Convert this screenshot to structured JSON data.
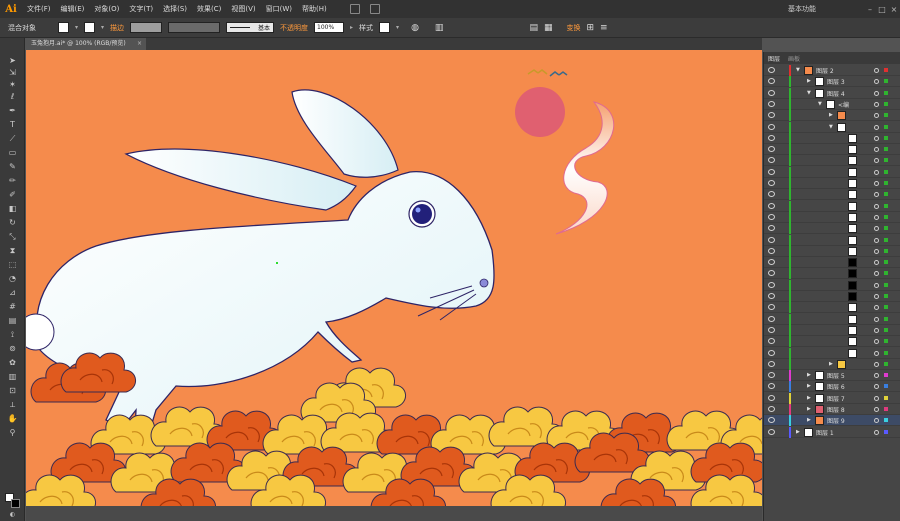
{
  "app": {
    "logo": "Ai",
    "workspace": "基本功能"
  },
  "menu": [
    "文件(F)",
    "编辑(E)",
    "对象(O)",
    "文字(T)",
    "选择(S)",
    "效果(C)",
    "视图(V)",
    "窗口(W)",
    "帮助(H)"
  ],
  "control": {
    "object_type": "混合对象",
    "stroke_label": "描边",
    "basic_label": "基本",
    "opacity_label": "不透明度",
    "opacity_value": "100%",
    "style_label": "样式",
    "transform_label": "变换"
  },
  "tab": {
    "title": "玉兔抱月.ai* @ 100% (RGB/预览)",
    "close": "×"
  },
  "panel": {
    "tab_layers": "图层",
    "tab_artboards": "画板"
  },
  "layers": [
    {
      "name": "图层 2",
      "indent": 0,
      "color": "#e03030",
      "expanded": true,
      "thumb": "#f58b4c"
    },
    {
      "name": "图层 3",
      "indent": 1,
      "color": "#2fb52f",
      "expanded": false,
      "thumb": "#ffffff"
    },
    {
      "name": "图层 4",
      "indent": 1,
      "color": "#2fb52f",
      "expanded": true,
      "thumb": "#ffffff"
    },
    {
      "name": "<编",
      "indent": 2,
      "color": "#2fb52f",
      "expanded": true,
      "thumb": "#ffffff"
    },
    {
      "name": "",
      "indent": 3,
      "color": "#2fb52f",
      "expanded": false,
      "thumb": "#f58b4c"
    },
    {
      "name": "",
      "indent": 3,
      "color": "#2fb52f",
      "expanded": true,
      "thumb": "#ffffff"
    },
    {
      "name": "",
      "indent": 4,
      "color": "#2fb52f",
      "thumb": "#ffffff"
    },
    {
      "name": "",
      "indent": 4,
      "color": "#2fb52f",
      "thumb": "#ffffff"
    },
    {
      "name": "",
      "indent": 4,
      "color": "#2fb52f",
      "thumb": "#ffffff"
    },
    {
      "name": "",
      "indent": 4,
      "color": "#2fb52f",
      "thumb": "#ffffff"
    },
    {
      "name": "",
      "indent": 4,
      "color": "#2fb52f",
      "thumb": "#ffffff"
    },
    {
      "name": "",
      "indent": 4,
      "color": "#2fb52f",
      "thumb": "#ffffff"
    },
    {
      "name": "",
      "indent": 4,
      "color": "#2fb52f",
      "thumb": "#ffffff"
    },
    {
      "name": "",
      "indent": 4,
      "color": "#2fb52f",
      "thumb": "#ffffff"
    },
    {
      "name": "",
      "indent": 4,
      "color": "#2fb52f",
      "thumb": "#ffffff"
    },
    {
      "name": "",
      "indent": 4,
      "color": "#2fb52f",
      "thumb": "#ffffff"
    },
    {
      "name": "",
      "indent": 4,
      "color": "#2fb52f",
      "thumb": "#ffffff"
    },
    {
      "name": "",
      "indent": 4,
      "color": "#2fb52f",
      "thumb": "#000000"
    },
    {
      "name": "",
      "indent": 4,
      "color": "#2fb52f",
      "thumb": "#000000"
    },
    {
      "name": "",
      "indent": 4,
      "color": "#2fb52f",
      "thumb": "#000000"
    },
    {
      "name": "",
      "indent": 4,
      "color": "#2fb52f",
      "thumb": "#000000"
    },
    {
      "name": "",
      "indent": 4,
      "color": "#2fb52f",
      "thumb": "#ffffff"
    },
    {
      "name": "",
      "indent": 4,
      "color": "#2fb52f",
      "thumb": "#ffffff"
    },
    {
      "name": "",
      "indent": 4,
      "color": "#2fb52f",
      "thumb": "#ffffff"
    },
    {
      "name": "",
      "indent": 4,
      "color": "#2fb52f",
      "thumb": "#ffffff"
    },
    {
      "name": "",
      "indent": 4,
      "color": "#2fb52f",
      "thumb": "#ffffff"
    },
    {
      "name": "",
      "indent": 3,
      "color": "#2fb52f",
      "expanded": false,
      "thumb": "#f7c842"
    },
    {
      "name": "图层 5",
      "indent": 1,
      "color": "#e03ad0",
      "expanded": false,
      "thumb": "#ffffff"
    },
    {
      "name": "图层 6",
      "indent": 1,
      "color": "#3a7fe0",
      "expanded": false,
      "thumb": "#ffffff"
    },
    {
      "name": "图层 7",
      "indent": 1,
      "color": "#e0d23a",
      "expanded": false,
      "thumb": "#ffffff"
    },
    {
      "name": "图层 8",
      "indent": 1,
      "color": "#e03a7f",
      "expanded": false,
      "thumb": "#e06070"
    },
    {
      "name": "图层 9",
      "indent": 1,
      "color": "#3ad0e0",
      "expanded": false,
      "thumb": "#f58b4c",
      "selected": true
    },
    {
      "name": "图层 1",
      "indent": 0,
      "color": "#5a5aff",
      "expanded": false,
      "thumb": "#ffffff"
    }
  ],
  "colors": {
    "canvas": "#f58b4c",
    "moon": "#e06070",
    "cloud_yellow": "#f7c842",
    "cloud_orange": "#e05a1e"
  }
}
